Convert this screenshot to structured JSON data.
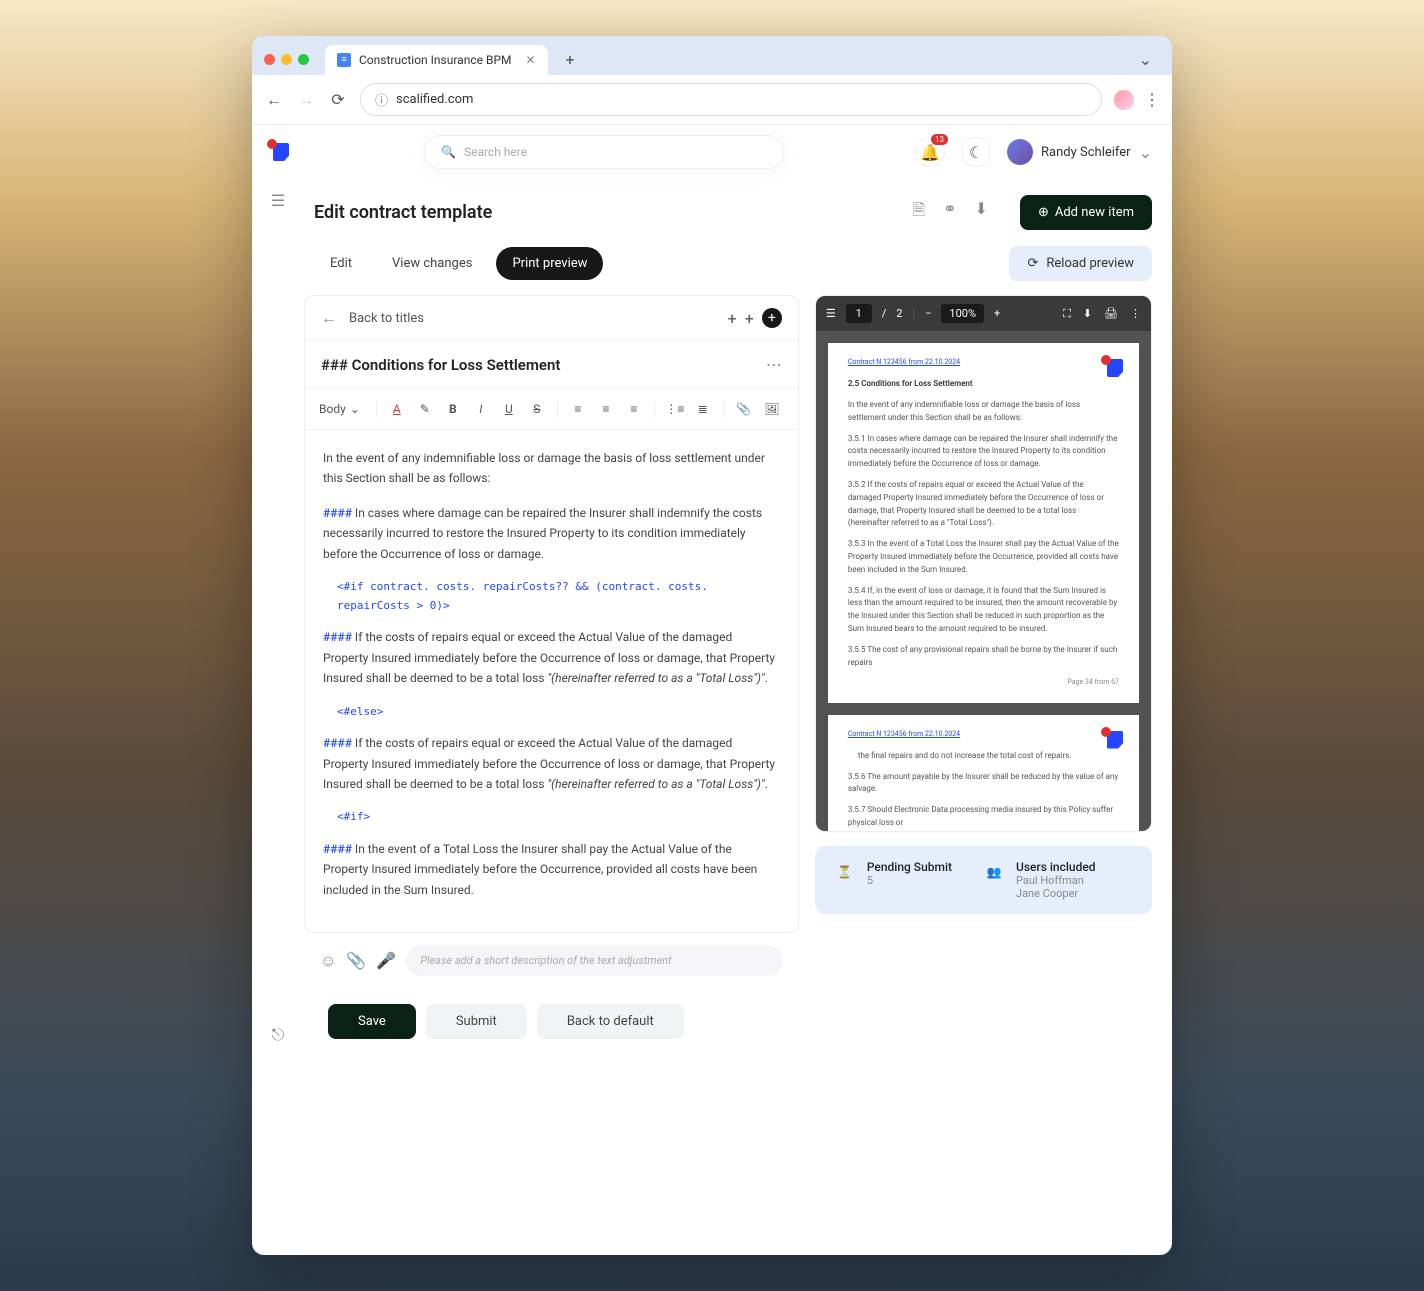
{
  "browser": {
    "tab_title": "Construction Insurance BPM",
    "url": "scalified.com"
  },
  "search": {
    "placeholder": "Search here"
  },
  "notifications": {
    "count": "13"
  },
  "user": {
    "name": "Randy Schleifer"
  },
  "page": {
    "title": "Edit contract template",
    "add_button": "Add  new item"
  },
  "tabs": {
    "edit": "Edit",
    "view": "View changes",
    "print": "Print preview",
    "reload": "Reload preview"
  },
  "editor": {
    "back": "Back to titles",
    "section_title": "### Conditions for Loss Settlement",
    "body_select": "Body",
    "intro": "In the event of any indemnifiable loss or damage the basis of loss settlement under this Section shall be as follows:",
    "h1": "####",
    "p1": " In cases where damage can be repaired the Insurer shall indemnify the costs necessarily incurred to restore the Insured Property to its condition immediately before the Occurrence of loss or damage.",
    "code1": "<#if contract. costs. repairCosts?? && (contract. costs. repairCosts > 0)>",
    "h2": "####",
    "p2": " If the costs of repairs equal or exceed the Actual Value of the damaged Property Insured immediately before the Occurrence of loss or damage, that Property Insured shall be deemed to be a total loss ",
    "quote": "\"(hereinafter referred to as a \"Total Loss\")\"",
    "code2": "<#else>",
    "h3": "####",
    "p3": " If the costs of repairs equal or exceed the Actual Value of the damaged Property Insured immediately before the Occurrence of loss or damage, that Property Insured shall be deemed to be a total loss ",
    "code3": "<#if>",
    "h4": "####",
    "p4": " In the event of a Total Loss the Insurer shall pay the Actual Value of the Property Insured immediately before the Occurrence, provided all costs have been included in the Sum Insured.",
    "desc_placeholder": "Please add  a short description of the text adjustment"
  },
  "actions": {
    "save": "Save",
    "submit": "Submit",
    "default": "Back to default"
  },
  "pdf": {
    "current_page": "1",
    "total_pages": "2",
    "zoom": "100%",
    "page1": {
      "header": "Contract N 123456 from 22.10.2024",
      "title": "2.5 Conditions for Loss Settlement",
      "intro": "In the event of any indemnifiable loss or damage the basis of loss settlement under this Section shall be as follows:",
      "p1": "3.5.1 In cases where damage can be repaired the Insurer shall indemnify the costs necessarily incurred to restore the Insured Property to its condition immediately before the Occurrence of loss or damage.",
      "p2": "3.5.2 If the costs of repairs equal or exceed the Actual Value of the damaged Property Insured immediately before the Occurrence of loss or damage, that Property Insured shall be deemed to be a total loss (hereinafter referred to as a \"Total Loss\").",
      "p3": "3.5.3 In the event of a Total Loss the Insurer shall pay the Actual Value of the Property Insured immediately before the Occurrence, provided all costs have been included in the Sum Insured.",
      "p4": "3.5.4 If, in the event of loss or damage, it is found that the Sum Insured is less than the amount required to be insured, then the amount recoverable by the Insured under this Section shall be reduced in such proportion as the Sum Insured bears to the amount required to be insured.",
      "p5": "3.5.5 The cost of any provisional repairs  shall be borne by the Insurer if such repairs",
      "pagenum": "Page 34 from 67"
    },
    "page2": {
      "header": "Contract N 123456 from 22.10.2024",
      "p0": "the final repairs and do not increase the total cost of repairs.",
      "p1": "3.5.6 The amount payable by the Insurer shall be reduced by the value of any salvage.",
      "p2": "3.5.7 Should Electronic Data processing media insured by this Policy suffer physical loss or"
    }
  },
  "footer": {
    "pending_label": "Pending Submit",
    "pending_count": "5",
    "users_label": "Users included",
    "user1": "Paul  Hoffman",
    "user2": "Jane Cooper"
  }
}
